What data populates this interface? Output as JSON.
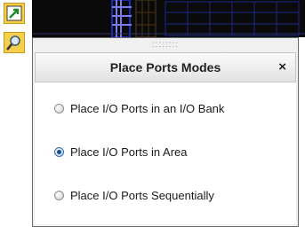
{
  "toolbar": {
    "tools": [
      {
        "icon": "place-ports-icon"
      },
      {
        "icon": "search-icon"
      }
    ]
  },
  "popup": {
    "title": "Place Ports Modes",
    "close_label": "×",
    "grip": "::::::::",
    "options": [
      {
        "label": "Place I/O Ports in an I/O Bank",
        "selected": false
      },
      {
        "label": "Place I/O Ports in Area",
        "selected": true
      },
      {
        "label": "Place I/O Ports Sequentially",
        "selected": false
      }
    ]
  }
}
